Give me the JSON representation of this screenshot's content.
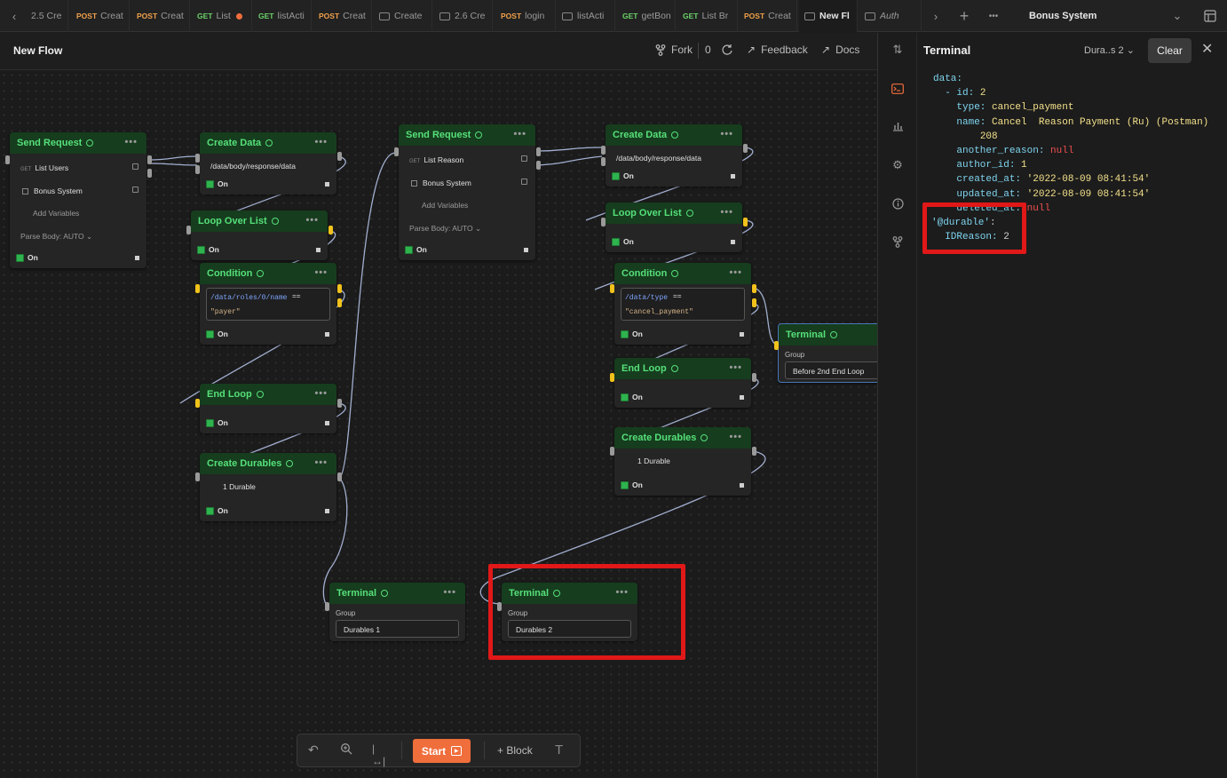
{
  "tabs": [
    {
      "method": "",
      "label": "2.5 Cre"
    },
    {
      "method": "POST",
      "label": "Creat"
    },
    {
      "method": "POST",
      "label": "Creat"
    },
    {
      "method": "GET",
      "label": "List"
    },
    {
      "method": "GET",
      "label": "listActi"
    },
    {
      "method": "POST",
      "label": "Creat"
    },
    {
      "method": "",
      "label": "Create"
    },
    {
      "method": "",
      "label": "2.6 Cre"
    },
    {
      "method": "POST",
      "label": "login"
    },
    {
      "method": "",
      "label": "listActi"
    },
    {
      "method": "GET",
      "label": "getBon"
    },
    {
      "method": "GET",
      "label": "List Br"
    },
    {
      "method": "POST",
      "label": "Creat"
    },
    {
      "method": "",
      "label": "New Fl"
    },
    {
      "method": "",
      "label": "Auth"
    }
  ],
  "workspace": "Bonus System",
  "flow": {
    "title": "New Flow",
    "fork_label": "Fork",
    "fork_count": "0",
    "feedback_label": "Feedback",
    "docs_label": "Docs"
  },
  "nodes": {
    "send1": {
      "title": "Send Request",
      "request": "List Users",
      "method": "GET",
      "collection": "Bonus System",
      "vars": "Add Variables",
      "parse": "Parse Body: AUTO",
      "on": "On"
    },
    "create1": {
      "title": "Create Data",
      "path": "/data/body/response/data",
      "on": "On"
    },
    "loop1": {
      "title": "Loop Over List",
      "on": "On"
    },
    "cond1": {
      "title": "Condition",
      "path": "/data/roles/0/name",
      "op": "==",
      "value": "\"payer\"",
      "on": "On"
    },
    "end1": {
      "title": "End Loop",
      "on": "On"
    },
    "dur1": {
      "title": "Create Durables",
      "count": "1 Durable",
      "on": "On"
    },
    "term1": {
      "title": "Terminal",
      "group_label": "Group",
      "group": "Durables 1"
    },
    "send2": {
      "title": "Send Request",
      "request": "List Reason",
      "method": "GET",
      "collection": "Bonus System",
      "vars": "Add Variables",
      "parse": "Parse Body: AUTO",
      "on": "On"
    },
    "create2": {
      "title": "Create Data",
      "path": "/data/body/response/data",
      "on": "On"
    },
    "loop2": {
      "title": "Loop Over List",
      "on": "On"
    },
    "cond2": {
      "title": "Condition",
      "path": "/data/type",
      "op": "==",
      "value": "\"cancel_payment\"",
      "on": "On"
    },
    "end2": {
      "title": "End Loop",
      "on": "On"
    },
    "dur2": {
      "title": "Create Durables",
      "count": "1 Durable",
      "on": "On"
    },
    "term2": {
      "title": "Terminal",
      "group_label": "Group",
      "group": "Durables 2"
    },
    "term3": {
      "title": "Terminal",
      "group_label": "Group",
      "group": "Before 2nd End Loop"
    }
  },
  "toolbar": {
    "start": "Start",
    "block": "Block"
  },
  "terminal": {
    "title": "Terminal",
    "selector": "Dura..s 2",
    "clear": "Clear",
    "out": {
      "data_key": "data:",
      "dash": "- ",
      "id_key": "id:",
      "id_val": "2",
      "type_key": "type:",
      "type_val": "cancel_payment",
      "name_key": "name:",
      "name_val": "Cancel  Reason Payment (Ru) (Postman)",
      "name_cont": "208",
      "another_key": "another_reason:",
      "another_val": "null",
      "author_key": "author_id:",
      "author_val": "1",
      "created_key": "created_at:",
      "created_val": "'2022-08-09 08:41:54'",
      "updated_key": "updated_at:",
      "updated_val": "'2022-08-09 08:41:54'",
      "deleted_key": "deleted_at:",
      "deleted_val": "null",
      "durable_key": "'@durable'",
      "colon": ":",
      "idreason_key": "IDReason:",
      "idreason_val": "2"
    }
  },
  "colors": {
    "accent": "#f06e3c",
    "node_header": "#163d1e",
    "node_title": "#55e079",
    "port_active": "#f1c21b",
    "highlight": "#e01818"
  }
}
